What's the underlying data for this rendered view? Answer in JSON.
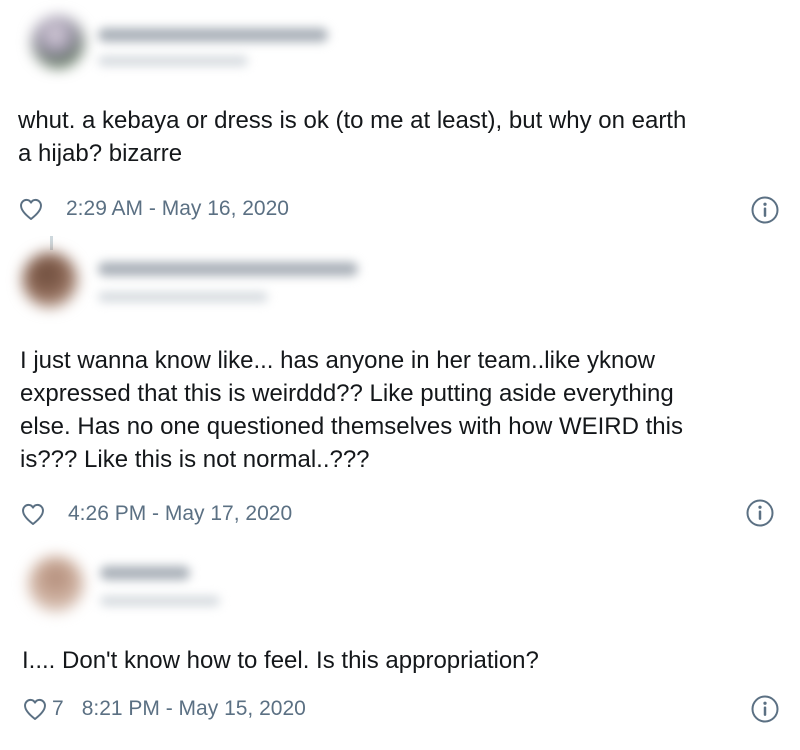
{
  "tweets": [
    {
      "text_lines": [
        "whut. a kebaya or dress is ok (to me at least), but why on earth",
        "a hijab? bizarre"
      ],
      "likes": "",
      "time": "2:29 AM - May 16, 2020"
    },
    {
      "text_lines": [
        "I just wanna know like... has anyone in her team..like yknow",
        "expressed that this is weirddd?? Like putting aside everything",
        "else. Has no one questioned themselves with how WEIRD this",
        "is??? Like this is not normal..???"
      ],
      "likes": "",
      "time": "4:26 PM - May 17, 2020"
    },
    {
      "text_lines": [
        "I.... Don't know how to feel. Is this appropriation?"
      ],
      "likes": "7",
      "time": "8:21 PM - May 15, 2020"
    }
  ],
  "icons": {
    "like": "heart-outline-icon",
    "info": "info-circle-icon"
  },
  "colors": {
    "text": "#14171a",
    "meta": "#5b7083",
    "icon": "#5b7083"
  }
}
